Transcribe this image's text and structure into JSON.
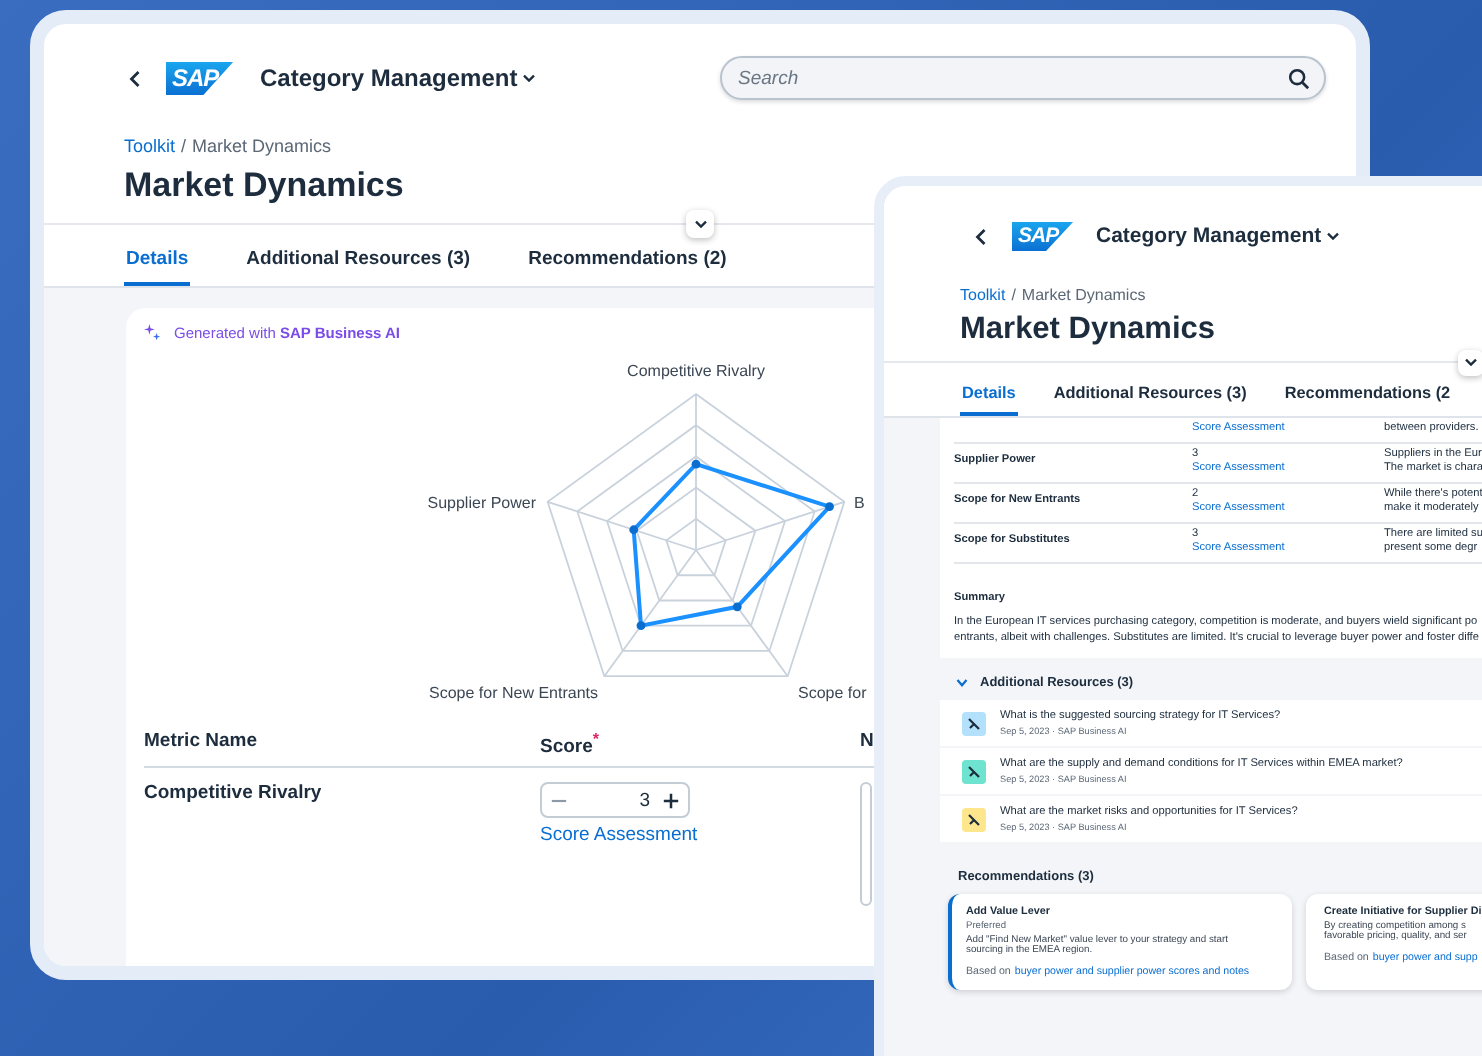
{
  "back_window": {
    "header": {
      "logo": "SAP",
      "app_title": "Category Management",
      "search": {
        "placeholder": "Search"
      }
    },
    "breadcrumb": {
      "link": "Toolkit",
      "separator": "/",
      "current": "Market Dynamics"
    },
    "title": "Market Dynamics",
    "tabs": [
      {
        "label": "Details",
        "selected": true
      },
      {
        "label": "Additional Resources (3)",
        "selected": false
      },
      {
        "label": "Recommendations (2)",
        "selected": false
      }
    ],
    "ai_note": "Generated with **SAP Business AI**",
    "radar_labels": [
      "Competitive Rivalry",
      "Supplier Power",
      "B",
      "Scope for New Entrants",
      "Scope for"
    ],
    "table": {
      "columns": [
        {
          "label": "Metric Name"
        },
        {
          "label": "Score",
          "required_mark": "*"
        },
        {
          "label": "N"
        }
      ],
      "rows": [
        {
          "metric": "Competitive Rivalry",
          "score": "3",
          "link": "Score Assessment"
        }
      ]
    }
  },
  "front_window": {
    "header": {
      "logo": "SAP",
      "app_title": "Category Management"
    },
    "breadcrumb": {
      "link": "Toolkit",
      "separator": "/",
      "current": "Market Dynamics"
    },
    "title": "Market Dynamics",
    "tabs": [
      {
        "label": "Details",
        "selected": true
      },
      {
        "label": "Additional Resources (3)",
        "selected": false
      },
      {
        "label": "Recommendations (2",
        "selected": false
      }
    ],
    "table_rows": [
      {
        "link": "Score Assessment",
        "notes": [
          "between providers."
        ]
      },
      {
        "metric": "Supplier Power",
        "score": "3",
        "link": "Score Assessment",
        "notes": [
          "Suppliers in the Eur",
          "The market is chara"
        ]
      },
      {
        "metric": "Scope for New Entrants",
        "score": "2",
        "link": "Score Assessment",
        "notes": [
          "While there's potent",
          "make it moderately"
        ]
      },
      {
        "metric": "Scope for Substitutes",
        "score": "3",
        "link": "Score Assessment",
        "notes": [
          "There are limited su",
          "present some degr"
        ]
      }
    ],
    "summary": {
      "heading": "Summary",
      "lines": [
        "In the European IT services purchasing category, competition is moderate, and buyers wield significant po",
        "entrants, albeit with challenges. Substitutes are limited. It's crucial to leverage buyer power and foster diffe"
      ]
    },
    "resources": {
      "heading": "Additional Resources (3)",
      "expanded": true,
      "items": [
        {
          "title": "What is the suggested sourcing strategy for IT Services?",
          "meta": "Sep 5, 2023 · SAP Business AI",
          "color": "#b3e0fb"
        },
        {
          "title": "What are the supply and demand conditions for IT Services within EMEA market?",
          "meta": "Sep 5, 2023 · SAP Business AI",
          "color": "#6ee3cf"
        },
        {
          "title": "What are the market risks and opportunities for IT Services?",
          "meta": "Sep 5, 2023 · SAP Business AI",
          "color": "#fde68c"
        }
      ]
    },
    "recommendations": {
      "heading": "Recommendations (3)",
      "cards": [
        {
          "title": "Add Value Lever",
          "tag": "Preferred",
          "lines": [
            "Add \"Find New Market\" value lever to your strategy and start",
            "sourcing in the EMEA region."
          ],
          "basis": "Based on",
          "link": "buyer power and supplier power scores and notes",
          "selected": true
        },
        {
          "title": "Create Initiative for Supplier Di",
          "lines": [
            "By creating competition among s",
            "favorable pricing, quality, and ser"
          ],
          "basis": "Based on",
          "link": "buyer power and supp",
          "selected": false
        }
      ]
    }
  }
}
